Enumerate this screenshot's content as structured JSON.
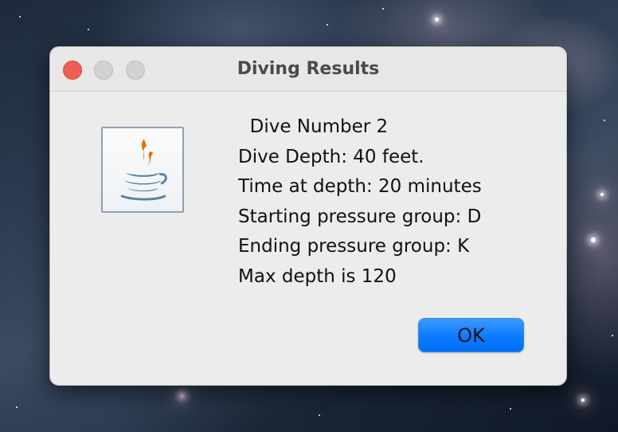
{
  "window": {
    "title": "Diving Results",
    "controls": {
      "close": "close-button",
      "minimize": "minimize-button",
      "zoom": "zoom-button"
    }
  },
  "dialog": {
    "icon": "java-icon",
    "message_lines": [
      "  Dive Number 2",
      "Dive Depth: 40 feet.",
      "Time at depth: 20 minutes",
      "Starting pressure group: D",
      "Ending pressure group: K",
      "Max depth is 120"
    ],
    "ok_label": "OK"
  },
  "colors": {
    "accent": "#0a7bff",
    "close": "#ee5e57",
    "dialog_bg": "#ececec"
  }
}
